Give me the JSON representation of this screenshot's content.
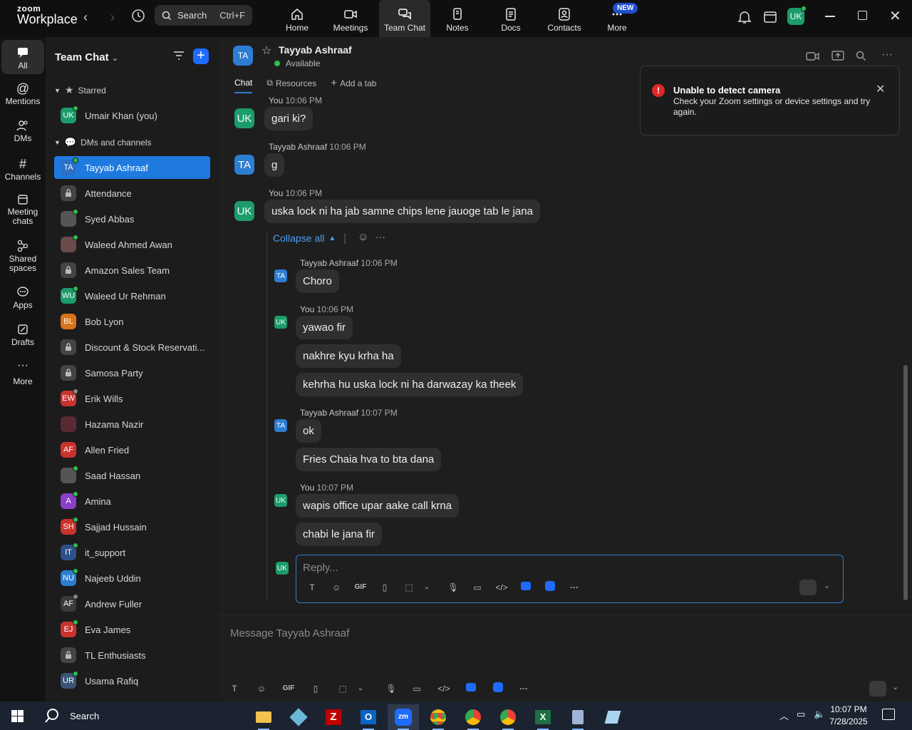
{
  "app": {
    "logo_top": "zoom",
    "logo_bottom": "Workplace"
  },
  "search": {
    "label": "Search",
    "shortcut": "Ctrl+F"
  },
  "top_tabs": [
    {
      "label": "Home",
      "icon": "home-icon"
    },
    {
      "label": "Meetings",
      "icon": "meetings-icon"
    },
    {
      "label": "Team Chat",
      "icon": "team-chat-icon",
      "active": true
    },
    {
      "label": "Notes",
      "icon": "notes-icon"
    },
    {
      "label": "Docs",
      "icon": "docs-icon"
    },
    {
      "label": "Contacts",
      "icon": "contacts-icon"
    },
    {
      "label": "More",
      "icon": "more-icon",
      "badge": "NEW"
    }
  ],
  "user_avatar": "UK",
  "sidebar": [
    {
      "label": "All"
    },
    {
      "label": "Mentions"
    },
    {
      "label": "DMs"
    },
    {
      "label": "Channels"
    },
    {
      "label": "Meeting chats"
    },
    {
      "label": "Shared spaces"
    },
    {
      "label": "Apps"
    },
    {
      "label": "Drafts"
    },
    {
      "label": "More"
    }
  ],
  "panel": {
    "title": "Team Chat",
    "starred_header": "Starred",
    "starred": [
      {
        "label": "Umair Khan (you)",
        "initials": "UK",
        "color": "#1c9c6a"
      }
    ],
    "dms_header": "DMs and channels",
    "items": [
      {
        "label": "Tayyab Ashraaf",
        "initials": "TA",
        "color": "#2d7dd2",
        "selected": true
      },
      {
        "label": "Attendance",
        "initials": "🔒",
        "color": "#444"
      },
      {
        "label": "Syed Abbas",
        "initials": "",
        "color": "#555"
      },
      {
        "label": "Waleed Ahmed Awan",
        "initials": "",
        "color": "#6a4a4a"
      },
      {
        "label": "Amazon Sales Team",
        "initials": "🔒",
        "color": "#444"
      },
      {
        "label": "Waleed Ur Rehman",
        "initials": "WU",
        "color": "#1c9c6a"
      },
      {
        "label": "Bob Lyon",
        "initials": "BL",
        "color": "#d9741b"
      },
      {
        "label": "Discount & Stock Reservati...",
        "initials": "🔒",
        "color": "#444"
      },
      {
        "label": "Samosa Party",
        "initials": "🔒",
        "color": "#444"
      },
      {
        "label": "Erik Wills",
        "initials": "EW",
        "color": "#c9332e"
      },
      {
        "label": "Hazama Nazir",
        "initials": "",
        "color": "#5a2a33"
      },
      {
        "label": "Allen Fried",
        "initials": "AF",
        "color": "#c9332e"
      },
      {
        "label": "Saad Hassan",
        "initials": "",
        "color": "#555"
      },
      {
        "label": "Amina",
        "initials": "A",
        "color": "#8a3fc7"
      },
      {
        "label": "Sajjad Hussain",
        "initials": "SH",
        "color": "#c9332e"
      },
      {
        "label": "it_support",
        "initials": "IT",
        "color": "#2d4f8a"
      },
      {
        "label": "Najeeb Uddin",
        "initials": "NU",
        "color": "#2d7dd2"
      },
      {
        "label": "Andrew Fuller",
        "initials": "AF",
        "color": "#3a3a3a"
      },
      {
        "label": "Eva James",
        "initials": "EJ",
        "color": "#c9332e"
      },
      {
        "label": "TL Enthusiasts",
        "initials": "🔒",
        "color": "#444"
      },
      {
        "label": "Usama Rafiq",
        "initials": "UR",
        "color": "#3a5577"
      }
    ]
  },
  "chat": {
    "name": "Tayyab Ashraaf",
    "status": "Available",
    "avatar": "TA",
    "tabs": {
      "chat": "Chat",
      "resources": "Resources",
      "add": "Add a tab"
    },
    "messages": [
      {
        "sender": "You",
        "time": "10:06 PM",
        "avatar": "UK",
        "text": "gari ki?"
      },
      {
        "sender": "Tayyab Ashraaf",
        "time": "10:06 PM",
        "avatar": "TA",
        "text": "g"
      },
      {
        "sender": "You",
        "time": "10:06 PM",
        "avatar": "UK",
        "text": "uska lock ni ha jab samne chips lene jauoge tab le jana"
      }
    ],
    "collapse": "Collapse all",
    "thread": [
      {
        "sender": "Tayyab Ashraaf",
        "time": "10:06 PM",
        "avatar": "TA",
        "texts": [
          "Choro"
        ]
      },
      {
        "sender": "You",
        "time": "10:06 PM",
        "avatar": "UK",
        "texts": [
          "yawao fir",
          "nakhre kyu krha ha",
          "kehrha hu uska lock ni ha darwazay ka theek"
        ]
      },
      {
        "sender": "Tayyab Ashraaf",
        "time": "10:07 PM",
        "avatar": "TA",
        "texts": [
          "ok",
          "Fries Chaia hva to bta dana"
        ]
      },
      {
        "sender": "You",
        "time": "10:07 PM",
        "avatar": "UK",
        "texts": [
          "wapis office upar aake call krna",
          "chabi le jana fir"
        ]
      }
    ],
    "reply_placeholder": "Reply...",
    "composer_placeholder": "Message Tayyab Ashraaf"
  },
  "toast": {
    "title": "Unable to detect camera",
    "body": "Check your Zoom settings or device settings and try again."
  },
  "taskbar": {
    "search": "Search",
    "time": "10:07 PM",
    "date": "7/28/2025"
  },
  "colors": {
    "accent": "#1f7ae0",
    "you_avatar": "#1c9c6a",
    "ta_avatar": "#2d7dd2"
  }
}
